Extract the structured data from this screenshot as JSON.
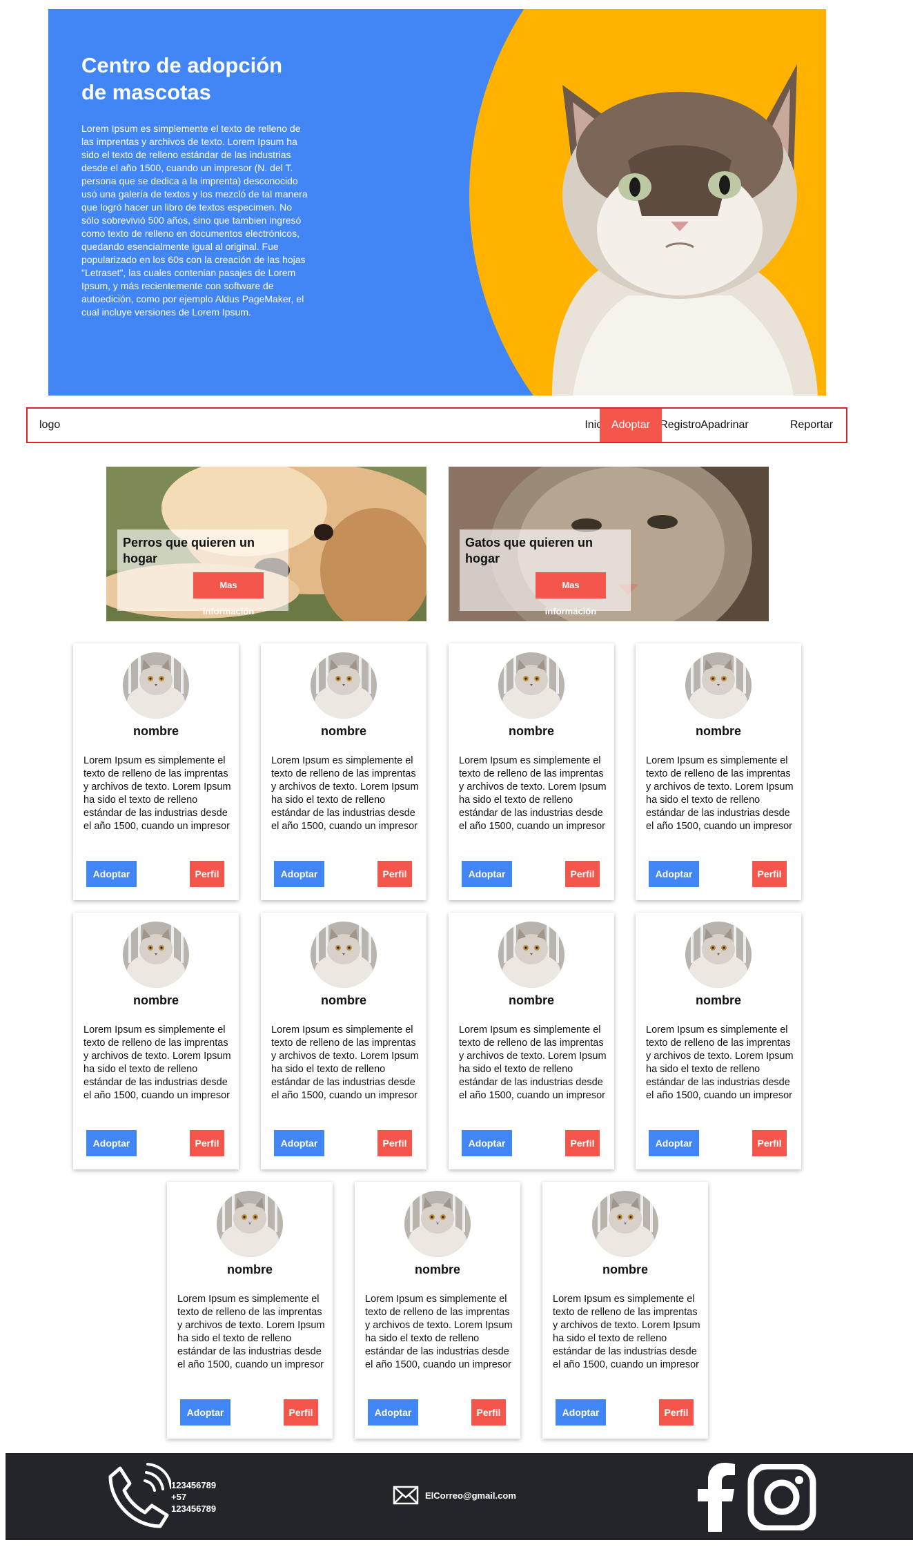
{
  "hero": {
    "title": "Centro de adopción de mascotas",
    "text": "Lorem Ipsum es simplemente el texto de relleno de las imprentas y archivos de texto. Lorem Ipsum ha sido el texto de relleno estándar de las industrias desde el año 1500, cuando un impresor (N. del T. persona que se dedica a la imprenta) desconocido usó una galería de textos y los mezcló de tal manera que logró hacer un libro de textos especimen. No sólo sobrevivió 500 años, sino que tambien ingresó como texto de relleno en documentos electrónicos, quedando esencialmente igual al original. Fue popularizado en los 60s con la creación de las hojas \"Letraset\", las cuales contenian pasajes de Lorem Ipsum, y más recientemente con software de autoedición, como por ejemplo Aldus PageMaker, el cual incluye versiones de Lorem Ipsum."
  },
  "nav": {
    "logo": "logo",
    "items": [
      {
        "label": "Inicio"
      },
      {
        "label": "Registro"
      },
      {
        "label": "Adoptar",
        "active": true
      },
      {
        "label": "Apadrinar"
      },
      {
        "label": "Reportar"
      }
    ]
  },
  "banners": [
    {
      "title": "Perros que quieren un hogar",
      "button": "Mas información"
    },
    {
      "title": "Gatos que quieren un hogar",
      "button": "Mas información"
    }
  ],
  "cards": [
    {
      "name": "nombre",
      "text": "Lorem Ipsum es simplemente el texto de relleno de las imprentas y archivos de texto. Lorem Ipsum ha sido el texto de relleno estándar de las industrias desde el año 1500, cuando un impresor",
      "adopt": "Adoptar",
      "profile": "Perfil"
    },
    {
      "name": "nombre",
      "text": "Lorem Ipsum es simplemente el texto de relleno de las imprentas y archivos de texto. Lorem Ipsum ha sido el texto de relleno estándar de las industrias desde el año 1500, cuando un impresor",
      "adopt": "Adoptar",
      "profile": "Perfil"
    },
    {
      "name": "nombre",
      "text": "Lorem Ipsum es simplemente el texto de relleno de las imprentas y archivos de texto. Lorem Ipsum ha sido el texto de relleno estándar de las industrias desde el año 1500, cuando un impresor",
      "adopt": "Adoptar",
      "profile": "Perfil"
    },
    {
      "name": "nombre",
      "text": "Lorem Ipsum es simplemente el texto de relleno de las imprentas y archivos de texto. Lorem Ipsum ha sido el texto de relleno estándar de las industrias desde el año 1500, cuando un impresor",
      "adopt": "Adoptar",
      "profile": "Perfil"
    },
    {
      "name": "nombre",
      "text": "Lorem Ipsum es simplemente el texto de relleno de las imprentas y archivos de texto. Lorem Ipsum ha sido el texto de relleno estándar de las industrias desde el año 1500, cuando un impresor",
      "adopt": "Adoptar",
      "profile": "Perfil"
    },
    {
      "name": "nombre",
      "text": "Lorem Ipsum es simplemente el texto de relleno de las imprentas y archivos de texto. Lorem Ipsum ha sido el texto de relleno estándar de las industrias desde el año 1500, cuando un impresor",
      "adopt": "Adoptar",
      "profile": "Perfil"
    },
    {
      "name": "nombre",
      "text": "Lorem Ipsum es simplemente el texto de relleno de las imprentas y archivos de texto. Lorem Ipsum ha sido el texto de relleno estándar de las industrias desde el año 1500, cuando un impresor",
      "adopt": "Adoptar",
      "profile": "Perfil"
    },
    {
      "name": "nombre",
      "text": "Lorem Ipsum es simplemente el texto de relleno de las imprentas y archivos de texto. Lorem Ipsum ha sido el texto de relleno estándar de las industrias desde el año 1500, cuando un impresor",
      "adopt": "Adoptar",
      "profile": "Perfil"
    },
    {
      "name": "nombre",
      "text": "Lorem Ipsum es simplemente el texto de relleno de las imprentas y archivos de texto. Lorem Ipsum ha sido el texto de relleno estándar de las industrias desde el año 1500, cuando un impresor",
      "adopt": "Adoptar",
      "profile": "Perfil"
    },
    {
      "name": "nombre",
      "text": "Lorem Ipsum es simplemente el texto de relleno de las imprentas y archivos de texto. Lorem Ipsum ha sido el texto de relleno estándar de las industrias desde el año 1500, cuando un impresor",
      "adopt": "Adoptar",
      "profile": "Perfil"
    },
    {
      "name": "nombre",
      "text": "Lorem Ipsum es simplemente el texto de relleno de las imprentas y archivos de texto. Lorem Ipsum ha sido el texto de relleno estándar de las industrias desde el año 1500, cuando un impresor",
      "adopt": "Adoptar",
      "profile": "Perfil"
    }
  ],
  "footer": {
    "phones": [
      "123456789",
      "+57",
      "123456789"
    ],
    "email": "ElCorreo@gmail.com",
    "icons": [
      "phone-icon",
      "mail-icon",
      "facebook-icon",
      "instagram-icon"
    ]
  },
  "colors": {
    "blue": "#4285f4",
    "yellow": "#ffb300",
    "red": "#f4564b",
    "nav_border": "#e0202a",
    "footer_bg": "#23252b"
  }
}
